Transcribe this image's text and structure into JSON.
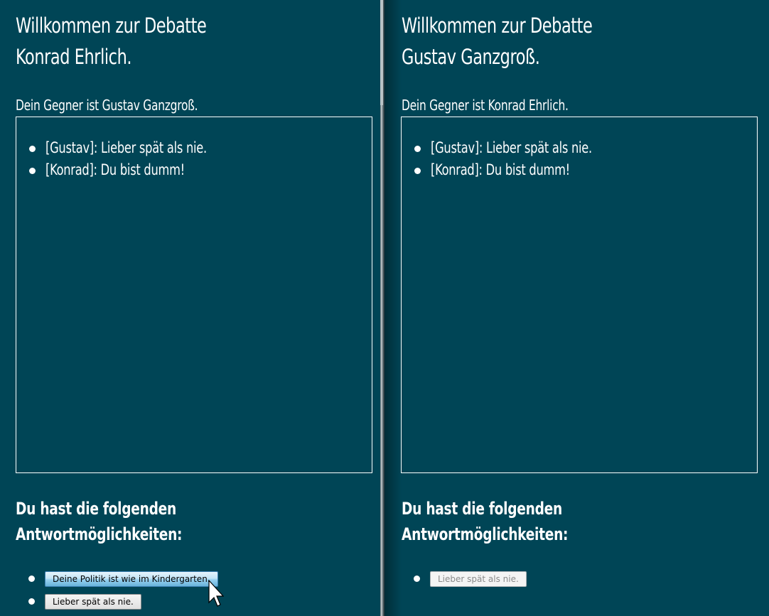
{
  "left": {
    "welcome_line1": "Willkommen zur Debatte",
    "welcome_line2": "Konrad Ehrlich.",
    "opponent": "Dein Gegner ist Gustav Ganzgroß.",
    "messages": [
      "[Gustav]: Lieber spät als nie.",
      "[Konrad]: Du bist dumm!"
    ],
    "options_heading_line1": "Du hast die folgenden",
    "options_heading_line2": "Antwortmöglichkeiten:",
    "options": [
      "Deine Politik ist wie im Kindergarten.",
      "Lieber spät als nie."
    ]
  },
  "right": {
    "welcome_line1": "Willkommen zur Debatte",
    "welcome_line2": "Gustav Ganzgroß.",
    "opponent": "Dein Gegner ist Konrad Ehrlich.",
    "messages": [
      "[Gustav]: Lieber spät als nie.",
      "[Konrad]: Du bist dumm!"
    ],
    "options_heading_line1": "Du hast die folgenden",
    "options_heading_line2": "Antwortmöglichkeiten:",
    "options": [
      "Lieber spät als nie."
    ]
  },
  "colors": {
    "background": "#004556",
    "text": "#ffffff"
  }
}
